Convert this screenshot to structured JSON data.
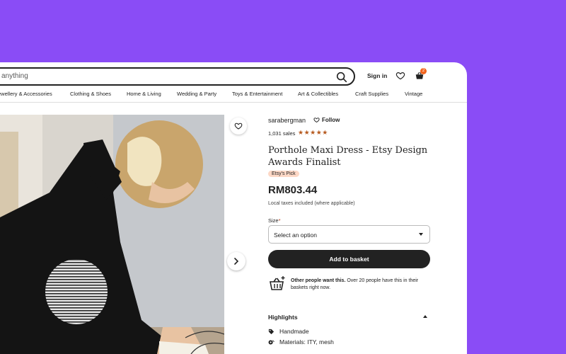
{
  "header": {
    "search_placeholder": "anything",
    "sign_in": "Sign in",
    "basket_count": "2"
  },
  "nav": [
    "ewellery & Accessories",
    "Clothing & Shoes",
    "Home & Living",
    "Wedding & Party",
    "Toys & Entertainment",
    "Art & Collectibles",
    "Craft Supplies",
    "Vintage"
  ],
  "product": {
    "shop_name": "sarabergman",
    "follow_label": "Follow",
    "sales": "1,031 sales",
    "rating_stars": "★★★★★",
    "rating": 5,
    "title": "Porthole Maxi Dress - Etsy Design Awards Finalist",
    "badge": "Etsy's Pick",
    "price": "RM803.44",
    "tax_note": "Local taxes included (where applicable)",
    "size_label": "Size",
    "required_mark": "*",
    "size_select": "Select an option",
    "add_to_basket": "Add to basket",
    "demand_bold": "Other people want this.",
    "demand_rest": " Over 20 people have this in their baskets right now.",
    "highlights_title": "Highlights",
    "highlights": [
      "Handmade",
      "Materials: ITY, mesh"
    ]
  },
  "colors": {
    "background": "#8a4cf6",
    "accent": "#f1641e",
    "stars": "#b65a1f",
    "button": "#222222",
    "badge_bg": "#fdd8c6"
  }
}
